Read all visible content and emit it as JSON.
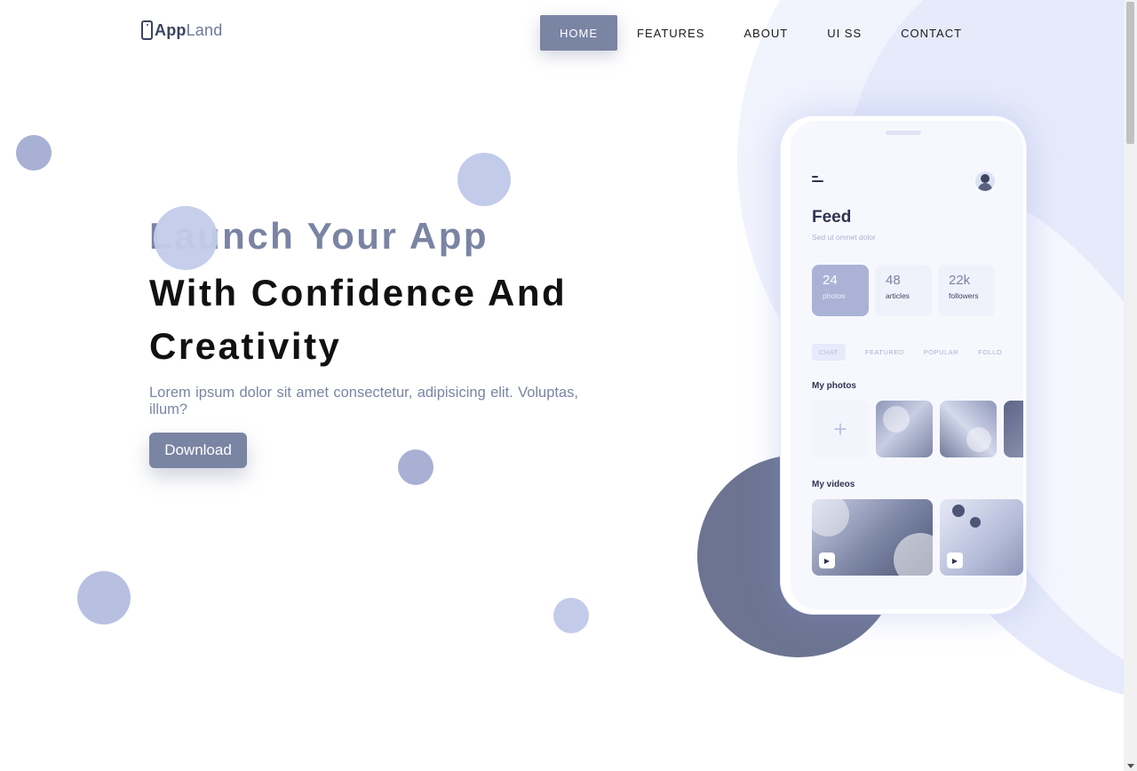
{
  "header": {
    "logo_primary": "App",
    "logo_secondary": "Land",
    "nav": [
      {
        "label": "HOME",
        "active": true
      },
      {
        "label": "FEATURES",
        "active": false
      },
      {
        "label": "ABOUT",
        "active": false
      },
      {
        "label": "UI SS",
        "active": false
      },
      {
        "label": "CONTACT",
        "active": false
      }
    ]
  },
  "hero": {
    "title_line1": "Launch Your App",
    "title_line2": "With Confidence And Creativity",
    "description": "Lorem ipsum dolor sit amet consectetur, adipisicing elit. Voluptas, illum?",
    "download_label": "Download"
  },
  "phone": {
    "feed_title": "Feed",
    "feed_subtitle": "Sed ut omnet dolor",
    "stats": [
      {
        "value": "24",
        "label": "photos"
      },
      {
        "value": "48",
        "label": "articles"
      },
      {
        "value": "22k",
        "label": "followers"
      }
    ],
    "tabs": [
      "CHAT",
      "FEATURED",
      "POPULAR",
      "FOLLO"
    ],
    "photos_title": "My photos",
    "add_glyph": "+",
    "videos_title": "My videos"
  },
  "icons": {
    "logo": "phone-icon",
    "menu": "menu-icon",
    "avatar": "avatar-icon",
    "play": "play-icon"
  },
  "colors": {
    "accent": "#7a84a3",
    "accent_light": "#c3cbeb",
    "dark": "#111111",
    "background": "#ffffff"
  }
}
